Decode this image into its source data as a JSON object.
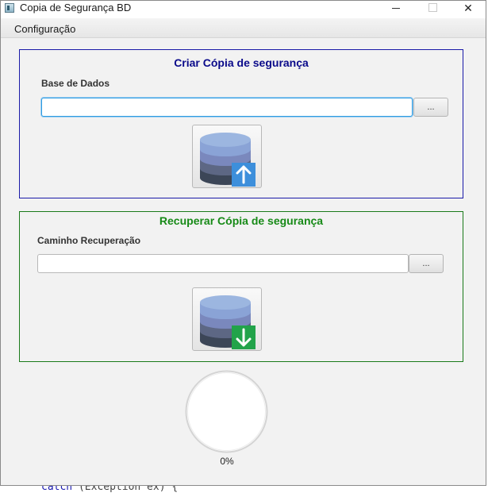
{
  "window": {
    "title": "Copia de Segurança BD",
    "controls": {
      "minimize": "—",
      "close": "✕"
    }
  },
  "menu": {
    "items": [
      "Configuração"
    ]
  },
  "create_panel": {
    "title": "Criar Cópia de segurança",
    "field_label": "Base de Dados",
    "field_value": "",
    "browse_label": "...",
    "arrow_color": "#3d8fdb"
  },
  "restore_panel": {
    "title": "Recuperar Cópia de segurança",
    "field_label": "Caminho Recuperação",
    "field_value": "",
    "browse_label": "...",
    "arrow_color": "#22a34a"
  },
  "progress": {
    "value": 0,
    "label": "0%"
  },
  "background_code": {
    "keyword": "catch",
    "rest": " (Exception ex) {"
  },
  "colors": {
    "create_border": "#1a1aa8",
    "create_title": "#0a0a8a",
    "restore_border": "#1a7a1a",
    "restore_title": "#178a17",
    "input_focus": "#2f9be0"
  }
}
